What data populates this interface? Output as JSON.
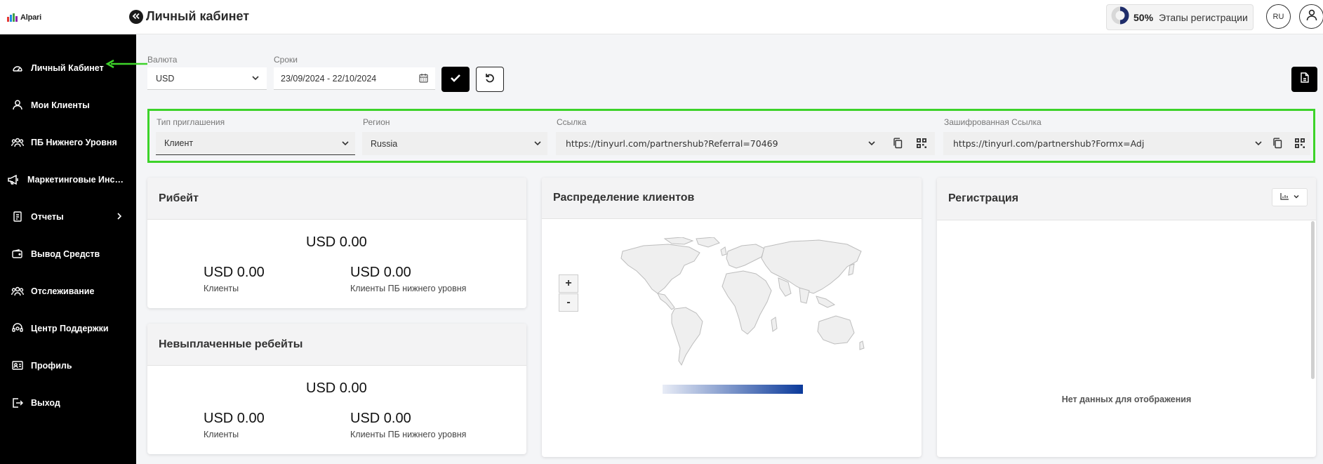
{
  "app": {
    "logo_text": "Alpari"
  },
  "header": {
    "title": "Личный кабинет",
    "registration_percent": "50%",
    "registration_label": "Этапы регистрации",
    "language": "RU"
  },
  "sidebar": {
    "items": [
      {
        "label": "Личный Кабинет",
        "icon": "dashboard-gauge-icon"
      },
      {
        "label": "Мои Клиенты",
        "icon": "user-icon"
      },
      {
        "label": "ПБ Нижнего Уровня",
        "icon": "users-group-icon"
      },
      {
        "label": "Маркетинговые Инструменты",
        "icon": "megaphone-icon"
      },
      {
        "label": "Отчеты",
        "icon": "report-icon"
      },
      {
        "label": "Вывод Средств",
        "icon": "wallet-icon"
      },
      {
        "label": "Отслеживание",
        "icon": "users-track-icon"
      },
      {
        "label": "Центр Поддержки",
        "icon": "support-icon"
      },
      {
        "label": "Профиль",
        "icon": "id-card-icon"
      },
      {
        "label": "Выход",
        "icon": "logout-icon"
      }
    ]
  },
  "filters": {
    "currency_label": "Валюта",
    "currency_value": "USD",
    "period_label": "Сроки",
    "period_value": "23/09/2024 - 22/10/2024"
  },
  "invite": {
    "type_label": "Тип приглашения",
    "type_value": "Клиент",
    "region_label": "Регион",
    "region_value": "Russia",
    "link_label": "Ссылка",
    "link_value": "https://tinyurl.com/partnershub?Referral=70469",
    "encrypted_label": "Зашифрованная Ссылка",
    "encrypted_value": "https://tinyurl.com/partnershub?Formx=Adj"
  },
  "rebate": {
    "title": "Рибейт",
    "total": "USD 0.00",
    "clients_value": "USD 0.00",
    "clients_label": "Клиенты",
    "sub_value": "USD 0.00",
    "sub_label": "Клиенты ПБ нижнего уровня"
  },
  "unpaid": {
    "title": "Невыплаченные ребейты",
    "total": "USD 0.00",
    "clients_value": "USD 0.00",
    "clients_label": "Клиенты",
    "sub_value": "USD 0.00",
    "sub_label": "Клиенты ПБ нижнего уровня"
  },
  "distribution": {
    "title": "Распределение клиентов",
    "zoom_in": "+",
    "zoom_out": "-"
  },
  "registration": {
    "title": "Регистрация",
    "empty_text": "Нет данных для отображения"
  },
  "colors": {
    "sidebar_bg": "#000000",
    "highlight": "#3dd32a",
    "accent_dark": "#000000",
    "gradient_start": "#e8ecf6",
    "gradient_end": "#0b3a9b"
  }
}
